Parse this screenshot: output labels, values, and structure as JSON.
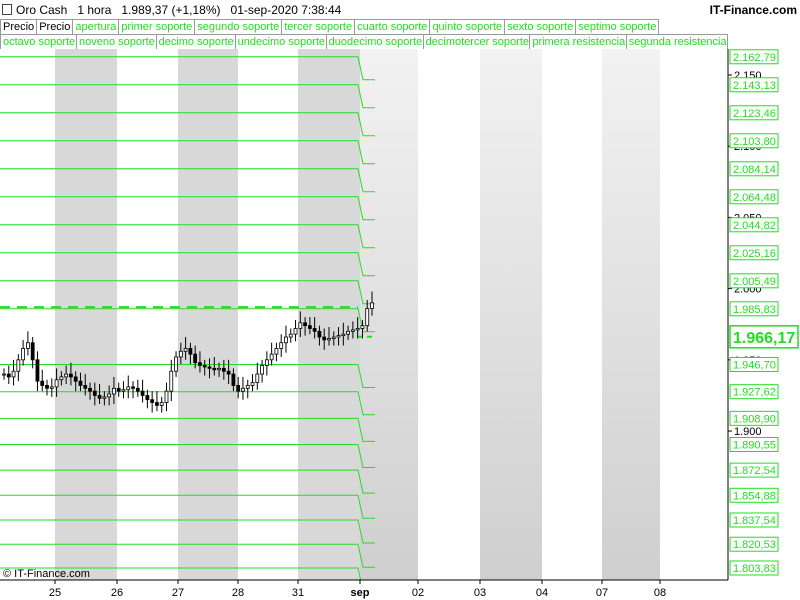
{
  "header": {
    "instrument": "Oro Cash",
    "timeframe": "1 hora",
    "last_price": "1.989,37",
    "change": "(+1,18%)",
    "datetime": "01-sep-2020 7:38:44",
    "brand": "IT-Finance.com"
  },
  "legend_row1": [
    "Precio",
    "Precio",
    "apertura",
    "primer soporte",
    "segundo soporte",
    "tercer soporte",
    "cuarto soporte",
    "quinto soporte",
    "sexto soporte",
    "septimo soporte"
  ],
  "legend_row2": [
    "octavo soporte",
    "noveno soporte",
    "decimo soporte",
    "undecimo soporte",
    "duodecimo soporte",
    "decimotercer soporte",
    "primera resistencia",
    "segunda resistencia"
  ],
  "watermark": "© IT-Finance.com",
  "colors": {
    "level_line": "#22dd22",
    "candle": "#000000",
    "shade": "#d8d8d8",
    "price_label": "#22dd22"
  },
  "chart_data": {
    "type": "line",
    "price_axis_ticks": [
      "2.150",
      "2.100",
      "2.050",
      "2.000",
      "1.950",
      "1.900"
    ],
    "x_tick_labels": [
      "25",
      "26",
      "27",
      "28",
      "31",
      "sep",
      "02",
      "03",
      "04",
      "07",
      "08"
    ],
    "current_price_label": "1.966,17",
    "levels": [
      {
        "label": "2.162,79",
        "value": 2162.79
      },
      {
        "label": "2.143,13",
        "value": 2143.13
      },
      {
        "label": "2.123,46",
        "value": 2123.46
      },
      {
        "label": "2.103,80",
        "value": 2103.8
      },
      {
        "label": "2.084,14",
        "value": 2084.14
      },
      {
        "label": "2.064,48",
        "value": 2064.48
      },
      {
        "label": "2.044,82",
        "value": 2044.82
      },
      {
        "label": "2.025,16",
        "value": 2025.16
      },
      {
        "label": "2.005,49",
        "value": 2005.49
      },
      {
        "label": "1.985,83",
        "value": 1985.83
      },
      {
        "label": "1.946,70",
        "value": 1946.7
      },
      {
        "label": "1.927,62",
        "value": 1927.62
      },
      {
        "label": "1.908,90",
        "value": 1908.9
      },
      {
        "label": "1.890,55",
        "value": 1890.55
      },
      {
        "label": "1.872,54",
        "value": 1872.54
      },
      {
        "label": "1.854,88",
        "value": 1854.88
      },
      {
        "label": "1.837,54",
        "value": 1837.54
      },
      {
        "label": "1.820,53",
        "value": 1820.53
      },
      {
        "label": "1.803,83",
        "value": 1803.83
      }
    ],
    "dashed_level": 1987.0,
    "current_price": 1966.17,
    "price_series_close": [
      1940,
      1938,
      1942,
      1950,
      1958,
      1962,
      1950,
      1935,
      1932,
      1930,
      1931,
      1936,
      1938,
      1940,
      1938,
      1935,
      1932,
      1930,
      1928,
      1925,
      1923,
      1924,
      1926,
      1930,
      1928,
      1929,
      1931,
      1930,
      1928,
      1925,
      1922,
      1920,
      1918,
      1920,
      1928,
      1942,
      1952,
      1956,
      1958,
      1954,
      1948,
      1946,
      1945,
      1944,
      1943,
      1944,
      1942,
      1940,
      1932,
      1928,
      1930,
      1932,
      1934,
      1940,
      1946,
      1950,
      1954,
      1958,
      1962,
      1966,
      1968,
      1972,
      1976,
      1974,
      1972,
      1970,
      1966,
      1964,
      1965,
      1966,
      1967,
      1968,
      1970,
      1971,
      1972,
      1974,
      1986,
      1990
    ]
  }
}
